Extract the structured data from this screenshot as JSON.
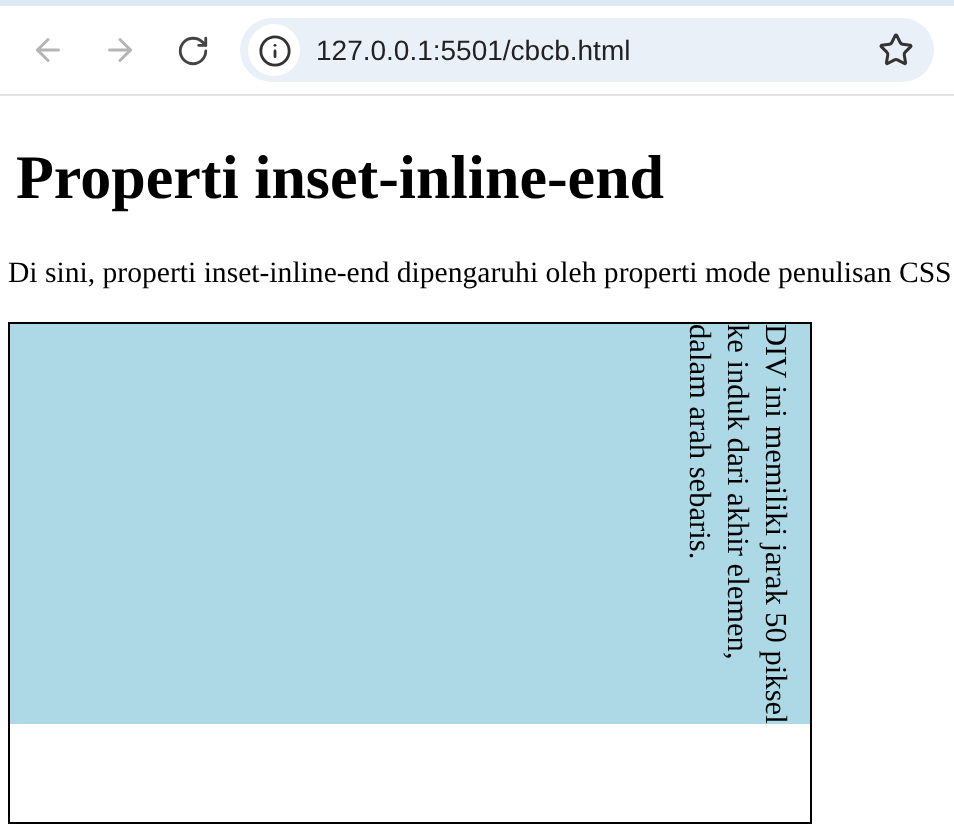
{
  "browser": {
    "url": "127.0.0.1:5501/cbcb.html",
    "back_disabled": true,
    "forward_disabled": true
  },
  "heading": "Properti inset-inline-end",
  "paragraph": "Di sini, properti inset-inline-end dipengaruhi oleh properti mode penulisan CSS",
  "demo_box": {
    "text": "DIV ini memiliki jarak 50 piksel ke induk dari akhir elemen, dalam arah sebaris."
  }
}
